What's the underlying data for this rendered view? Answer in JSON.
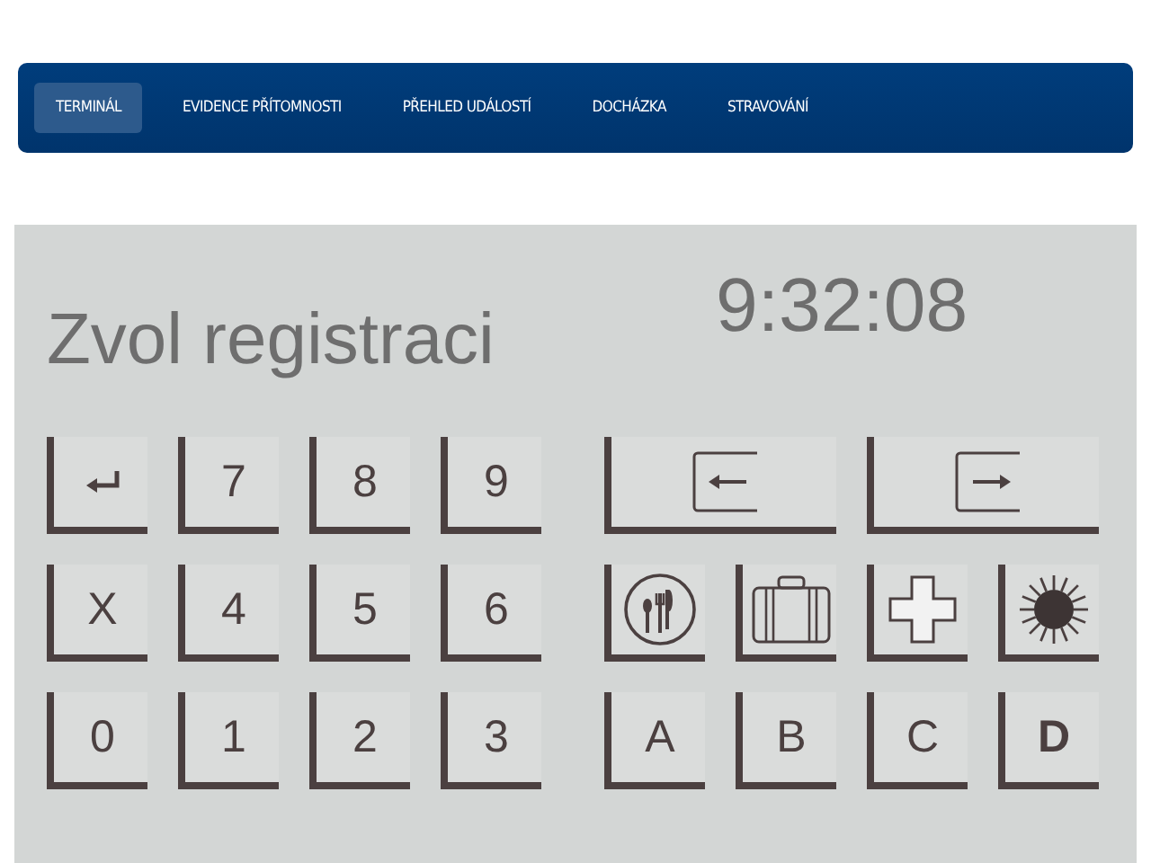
{
  "nav": {
    "tabs": [
      {
        "label": "TERMINÁL",
        "selected": true
      },
      {
        "label": "EVIDENCE PŘÍTOMNOSTI",
        "selected": false
      },
      {
        "label": "PŘEHLED UDÁLOSTÍ",
        "selected": false
      },
      {
        "label": "DOCHÁZKA",
        "selected": false
      },
      {
        "label": "STRAVOVÁNÍ",
        "selected": false
      }
    ]
  },
  "display": {
    "prompt": "Zvol registraci",
    "time": "9:32:08"
  },
  "numpad": [
    {
      "kind": "enter"
    },
    {
      "kind": "text",
      "label": "7"
    },
    {
      "kind": "text",
      "label": "8"
    },
    {
      "kind": "text",
      "label": "9"
    },
    {
      "kind": "text",
      "label": "X"
    },
    {
      "kind": "text",
      "label": "4"
    },
    {
      "kind": "text",
      "label": "5"
    },
    {
      "kind": "text",
      "label": "6"
    },
    {
      "kind": "text",
      "label": "0"
    },
    {
      "kind": "text",
      "label": "1"
    },
    {
      "kind": "text",
      "label": "2"
    },
    {
      "kind": "text",
      "label": "3"
    }
  ],
  "function_keys": [
    {
      "kind": "arrive"
    },
    {
      "kind": "leave"
    },
    {
      "kind": "meal"
    },
    {
      "kind": "business"
    },
    {
      "kind": "doctor"
    },
    {
      "kind": "sun"
    },
    {
      "kind": "text",
      "label": "A"
    },
    {
      "kind": "text",
      "label": "B"
    },
    {
      "kind": "text",
      "label": "C"
    },
    {
      "kind": "text",
      "label": "D"
    }
  ]
}
